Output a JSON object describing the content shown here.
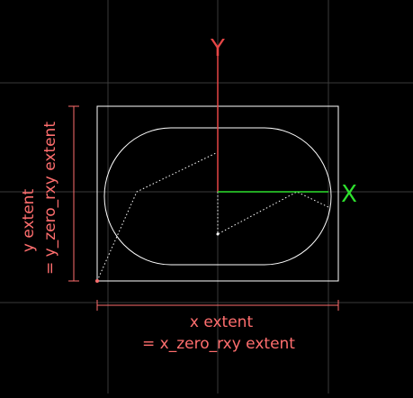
{
  "axes": {
    "y_label": "Y",
    "x_label": "X",
    "y_color": "#e64646",
    "x_color": "#2ee02e"
  },
  "annotations": {
    "x_extent_line1": "x extent",
    "x_extent_line2": "= x_zero_rxy extent",
    "y_extent_line1": "y extent",
    "y_extent_line2": "= y_zero_rxy extent",
    "annotation_color": "#ff6e6e"
  },
  "colors": {
    "background": "#000000",
    "grid": "#3a3a3a",
    "shape": "#ffffff"
  }
}
